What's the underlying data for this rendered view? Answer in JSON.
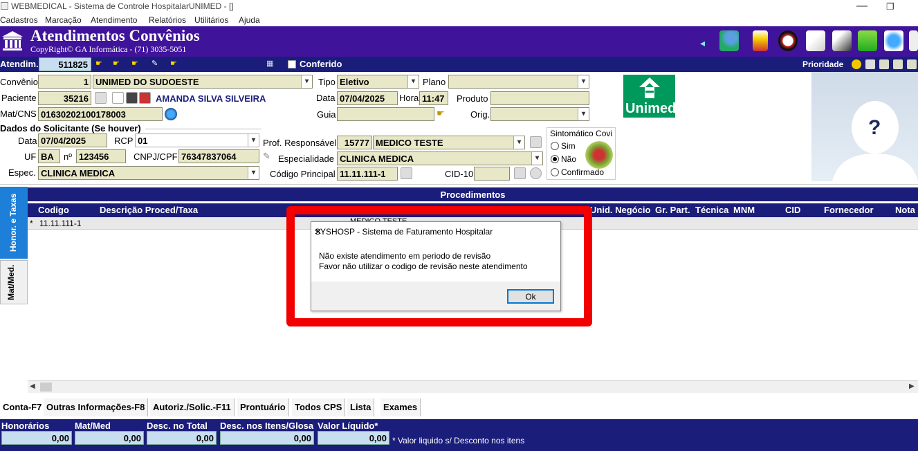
{
  "window": {
    "title": "WEBMEDICAL - Sistema de Controle HospitalarUNIMED - []",
    "minimize": "—",
    "restore": "❐"
  },
  "menu": [
    "Cadastros",
    "Marcação",
    "Atendimento",
    "Relatórios",
    "Utilitários",
    "Ajuda"
  ],
  "header": {
    "title": "Atendimentos Convênios",
    "subtitle": "CopyRight© GA Informática - (71) 3035-5051"
  },
  "toolbar": {
    "atendim_label": "Atendim.",
    "atendim_value": "511825",
    "conferido_label": "Conferido",
    "prioridade_label": "Prioridade"
  },
  "form": {
    "convenio_label": "Convênio",
    "convenio_code": "1",
    "convenio_name": "UNIMED DO SUDOESTE",
    "tipo_label": "Tipo",
    "tipo_value": "Eletivo",
    "plano_label": "Plano",
    "plano_value": "",
    "paciente_label": "Paciente",
    "paciente_code": "35216",
    "paciente_name": "AMANDA SILVA SILVEIRA",
    "data_label": "Data",
    "data_value": "07/04/2025",
    "hora_label": "Hora",
    "hora_value": "11:47",
    "produto_label": "Produto",
    "produto_value": "",
    "matcns_label": "Mat/CNS",
    "matcns_value": "01630202100178003",
    "guia_label": "Guia",
    "guia_value": "",
    "orig_label": "Orig.",
    "orig_value": ""
  },
  "solicitante": {
    "section_title": "Dados do Solicitante (Se houver)",
    "data_label": "Data",
    "data_value": "07/04/2025",
    "rcp_label": "RCP",
    "rcp_value": "01",
    "uf_label": "UF",
    "uf_value": "BA",
    "n_label": "nº",
    "n_value": "123456",
    "cnpj_label": "CNPJ/CPF",
    "cnpj_value": "76347837064",
    "espec_label": "Espec.",
    "espec_value": "CLINICA MEDICA"
  },
  "profissional": {
    "prof_label": "Prof. Responsável",
    "prof_code": "15777",
    "prof_name": "MEDICO TESTE",
    "esp_label": "Especialidade",
    "esp_value": "CLINICA MEDICA",
    "cod_label": "Código Principal",
    "cod_value": "11.11.111-1",
    "cid_label": "CID-10",
    "cid_value": ""
  },
  "sintomatico": {
    "title": "Sintomático Covi",
    "options": [
      "Sim",
      "Não",
      "Confirmado"
    ],
    "selected": "Não"
  },
  "logo_text": "Unimed",
  "photo_text": "?",
  "left_tabs": [
    "Honor. e Taxas",
    "Mat/Med."
  ],
  "procedimentos": {
    "title": "Procedimentos",
    "columns": [
      "Codigo",
      "Descrição Proced/Taxa",
      "Unid. Negócio",
      "Gr. Part.",
      "Técnica",
      "MNM",
      "CID",
      "Fornecedor",
      "Nota"
    ],
    "rows": [
      {
        "marker": "*",
        "codigo": "11.11.111-1",
        "medico": "MEDICO TESTE"
      }
    ]
  },
  "bottom_tabs": [
    "Conta-F7",
    "Outras Informações-F8",
    "Autoriz./Solic.-F11",
    "Prontuário",
    "Todos CPS",
    "Lista",
    "Exames"
  ],
  "totals": {
    "honorarios_label": "Honorários",
    "honorarios_value": "0,00",
    "matmed_label": "Mat/Med",
    "matmed_value": "0,00",
    "desc_total_label": "Desc. no Total",
    "desc_total_value": "0,00",
    "desc_itens_label": "Desc. nos Itens/Glosa",
    "desc_itens_value": "0,00",
    "liquido_label": "Valor Líquido*",
    "liquido_value": "0,00",
    "note": "* Valor liquido s/ Desconto nos itens"
  },
  "dialog": {
    "title": "SYSHOSP - Sistema de Faturamento Hospitalar",
    "line1": "Não existe atendimento em periodo de revisão",
    "line2": "Favor não utilizar o codigo de revisão neste atendimento",
    "ok_label": "Ok",
    "close": "✕"
  },
  "colors": {
    "header_purple": "#40149a",
    "toolbar_navy": "#1b1d7a",
    "highlight_red": "#f20000",
    "unimed_green": "#00995c"
  }
}
